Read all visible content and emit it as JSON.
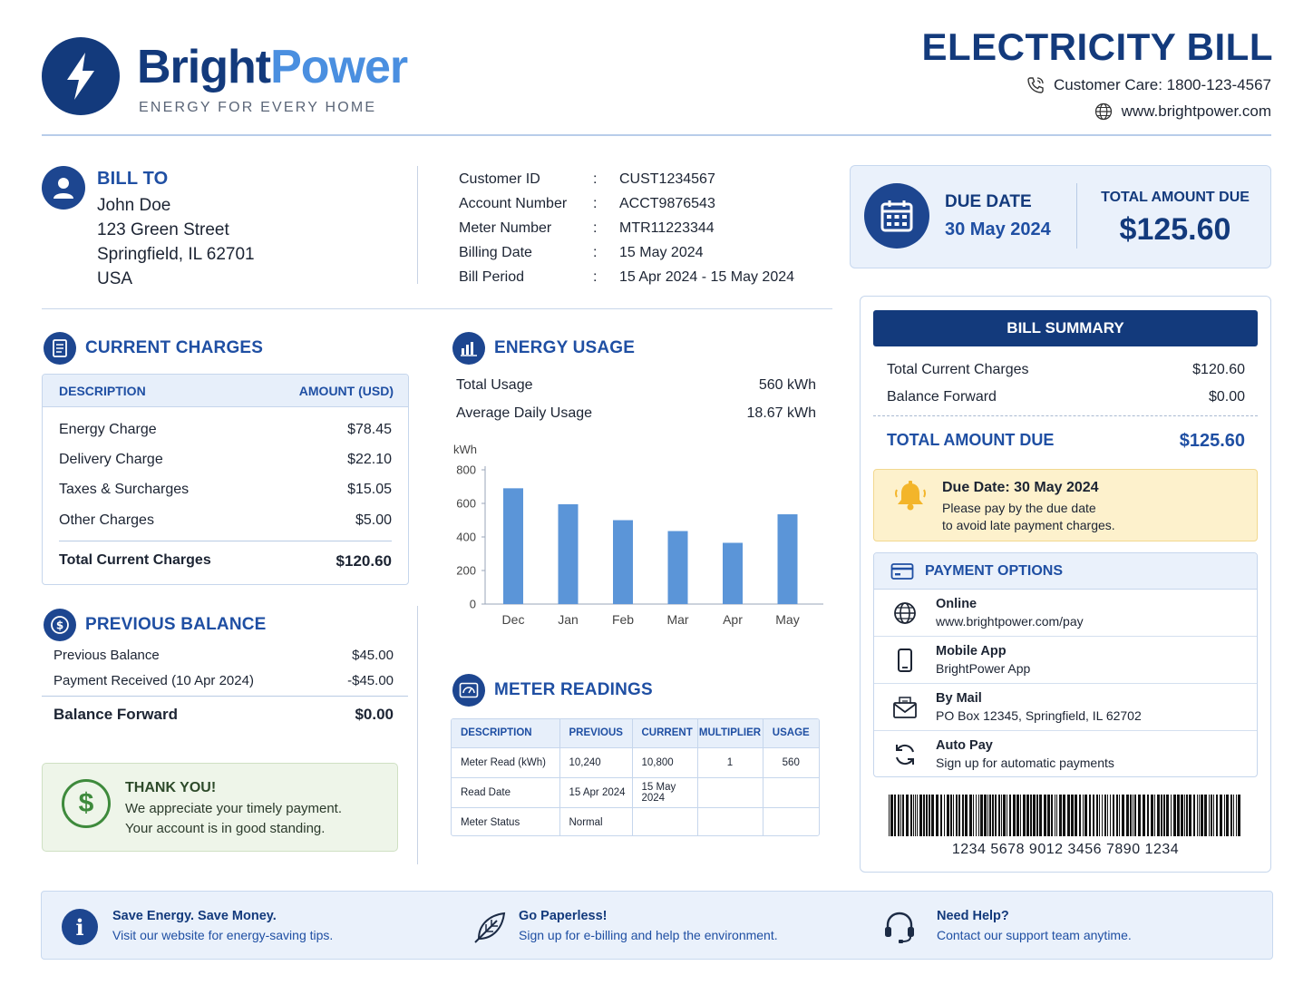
{
  "brand": {
    "name_part1": "Bright",
    "name_part2": "Power",
    "tagline": "ENERGY FOR EVERY HOME",
    "logo_icon": "lightning-bolt-icon",
    "primary_color": "#133a7c",
    "accent_color": "#4a8fe0"
  },
  "header": {
    "title": "ELECTRICITY BILL",
    "customer_care": "Customer Care: 1800-123-4567",
    "website": "www.brightpower.com"
  },
  "bill_to": {
    "heading": "BILL TO",
    "name": "John Doe",
    "street": "123 Green Street",
    "city": "Springfield, IL 62701",
    "country": "USA"
  },
  "account": {
    "rows": [
      {
        "label": "Customer ID",
        "value": "CUST1234567"
      },
      {
        "label": "Account Number",
        "value": "ACCT9876543"
      },
      {
        "label": "Meter Number",
        "value": "MTR11223344"
      },
      {
        "label": "Billing Date",
        "value": "15 May 2024"
      },
      {
        "label": "Bill Period",
        "value": "15 Apr 2024 - 15 May 2024"
      }
    ]
  },
  "due_card": {
    "due_label": "DUE DATE",
    "due_value": "30 May 2024",
    "total_label": "TOTAL AMOUNT DUE",
    "total_value": "$125.60"
  },
  "current_charges": {
    "heading": "CURRENT CHARGES",
    "col_desc": "DESCRIPTION",
    "col_amount": "AMOUNT (USD)",
    "items": [
      {
        "label": "Energy Charge",
        "value": "$78.45"
      },
      {
        "label": "Delivery Charge",
        "value": "$22.10"
      },
      {
        "label": "Taxes & Surcharges",
        "value": "$15.05"
      },
      {
        "label": "Other Charges",
        "value": "$5.00"
      }
    ],
    "total_label": "Total Current Charges",
    "total_value": "$120.60"
  },
  "previous_balance": {
    "heading": "PREVIOUS BALANCE",
    "items": [
      {
        "label": "Previous Balance",
        "value": "$45.00"
      },
      {
        "label": "Payment Received (10 Apr 2024)",
        "value": "-$45.00"
      }
    ],
    "forward_label": "Balance Forward",
    "forward_value": "$0.00"
  },
  "thank_you": {
    "title": "THANK YOU!",
    "line1": "We appreciate your timely payment.",
    "line2": "Your account is in good standing."
  },
  "energy_usage": {
    "heading": "ENERGY USAGE",
    "total_label": "Total Usage",
    "total_value": "560 kWh",
    "avg_label": "Average Daily Usage",
    "avg_value": "18.67 kWh"
  },
  "chart_data": {
    "type": "bar",
    "ylabel": "kWh",
    "categories": [
      "Dec",
      "Jan",
      "Feb",
      "Mar",
      "Apr",
      "May"
    ],
    "values": [
      690,
      595,
      500,
      435,
      365,
      535
    ],
    "ylim": [
      0,
      800
    ],
    "yticks": [
      0,
      200,
      400,
      600,
      800
    ],
    "bar_color": "#5b95d8",
    "grid": false
  },
  "meter": {
    "heading": "METER READINGS",
    "columns": [
      "DESCRIPTION",
      "PREVIOUS",
      "CURRENT",
      "MULTIPLIER",
      "USAGE"
    ],
    "rows": [
      [
        "Meter Read (kWh)",
        "10,240",
        "10,800",
        "1",
        "560"
      ],
      [
        "Read Date",
        "15 Apr 2024",
        "15 May 2024",
        "",
        ""
      ],
      [
        "Meter Status",
        "Normal",
        "",
        "",
        ""
      ]
    ]
  },
  "summary": {
    "heading": "BILL SUMMARY",
    "items": [
      {
        "label": "Total Current Charges",
        "value": "$120.60"
      },
      {
        "label": "Balance Forward",
        "value": "$0.00"
      }
    ],
    "total_label": "TOTAL AMOUNT DUE",
    "total_value": "$125.60",
    "alert_title": "Due Date: 30 May 2024",
    "alert_line1": "Please pay by the due date",
    "alert_line2": "to avoid late payment charges."
  },
  "payment": {
    "heading": "PAYMENT OPTIONS",
    "options": [
      {
        "icon": "globe-icon",
        "title": "Online",
        "detail": "www.brightpower.com/pay"
      },
      {
        "icon": "mobile-phone-icon",
        "title": "Mobile App",
        "detail": "BrightPower App"
      },
      {
        "icon": "mail-icon",
        "title": "By Mail",
        "detail": "PO Box 12345, Springfield, IL 62702"
      },
      {
        "icon": "refresh-icon",
        "title": "Auto Pay",
        "detail": "Sign up for automatic payments"
      }
    ]
  },
  "barcode": {
    "number": "1234 5678 9012 3456 7890 1234"
  },
  "footer": {
    "items": [
      {
        "icon": "info-icon",
        "title": "Save Energy. Save Money.",
        "detail": "Visit our website for energy-saving tips."
      },
      {
        "icon": "leaf-icon",
        "title": "Go Paperless!",
        "detail": "Sign up for e-billing and help the environment."
      },
      {
        "icon": "headset-icon",
        "title": "Need Help?",
        "detail": "Contact our support team anytime."
      }
    ]
  }
}
